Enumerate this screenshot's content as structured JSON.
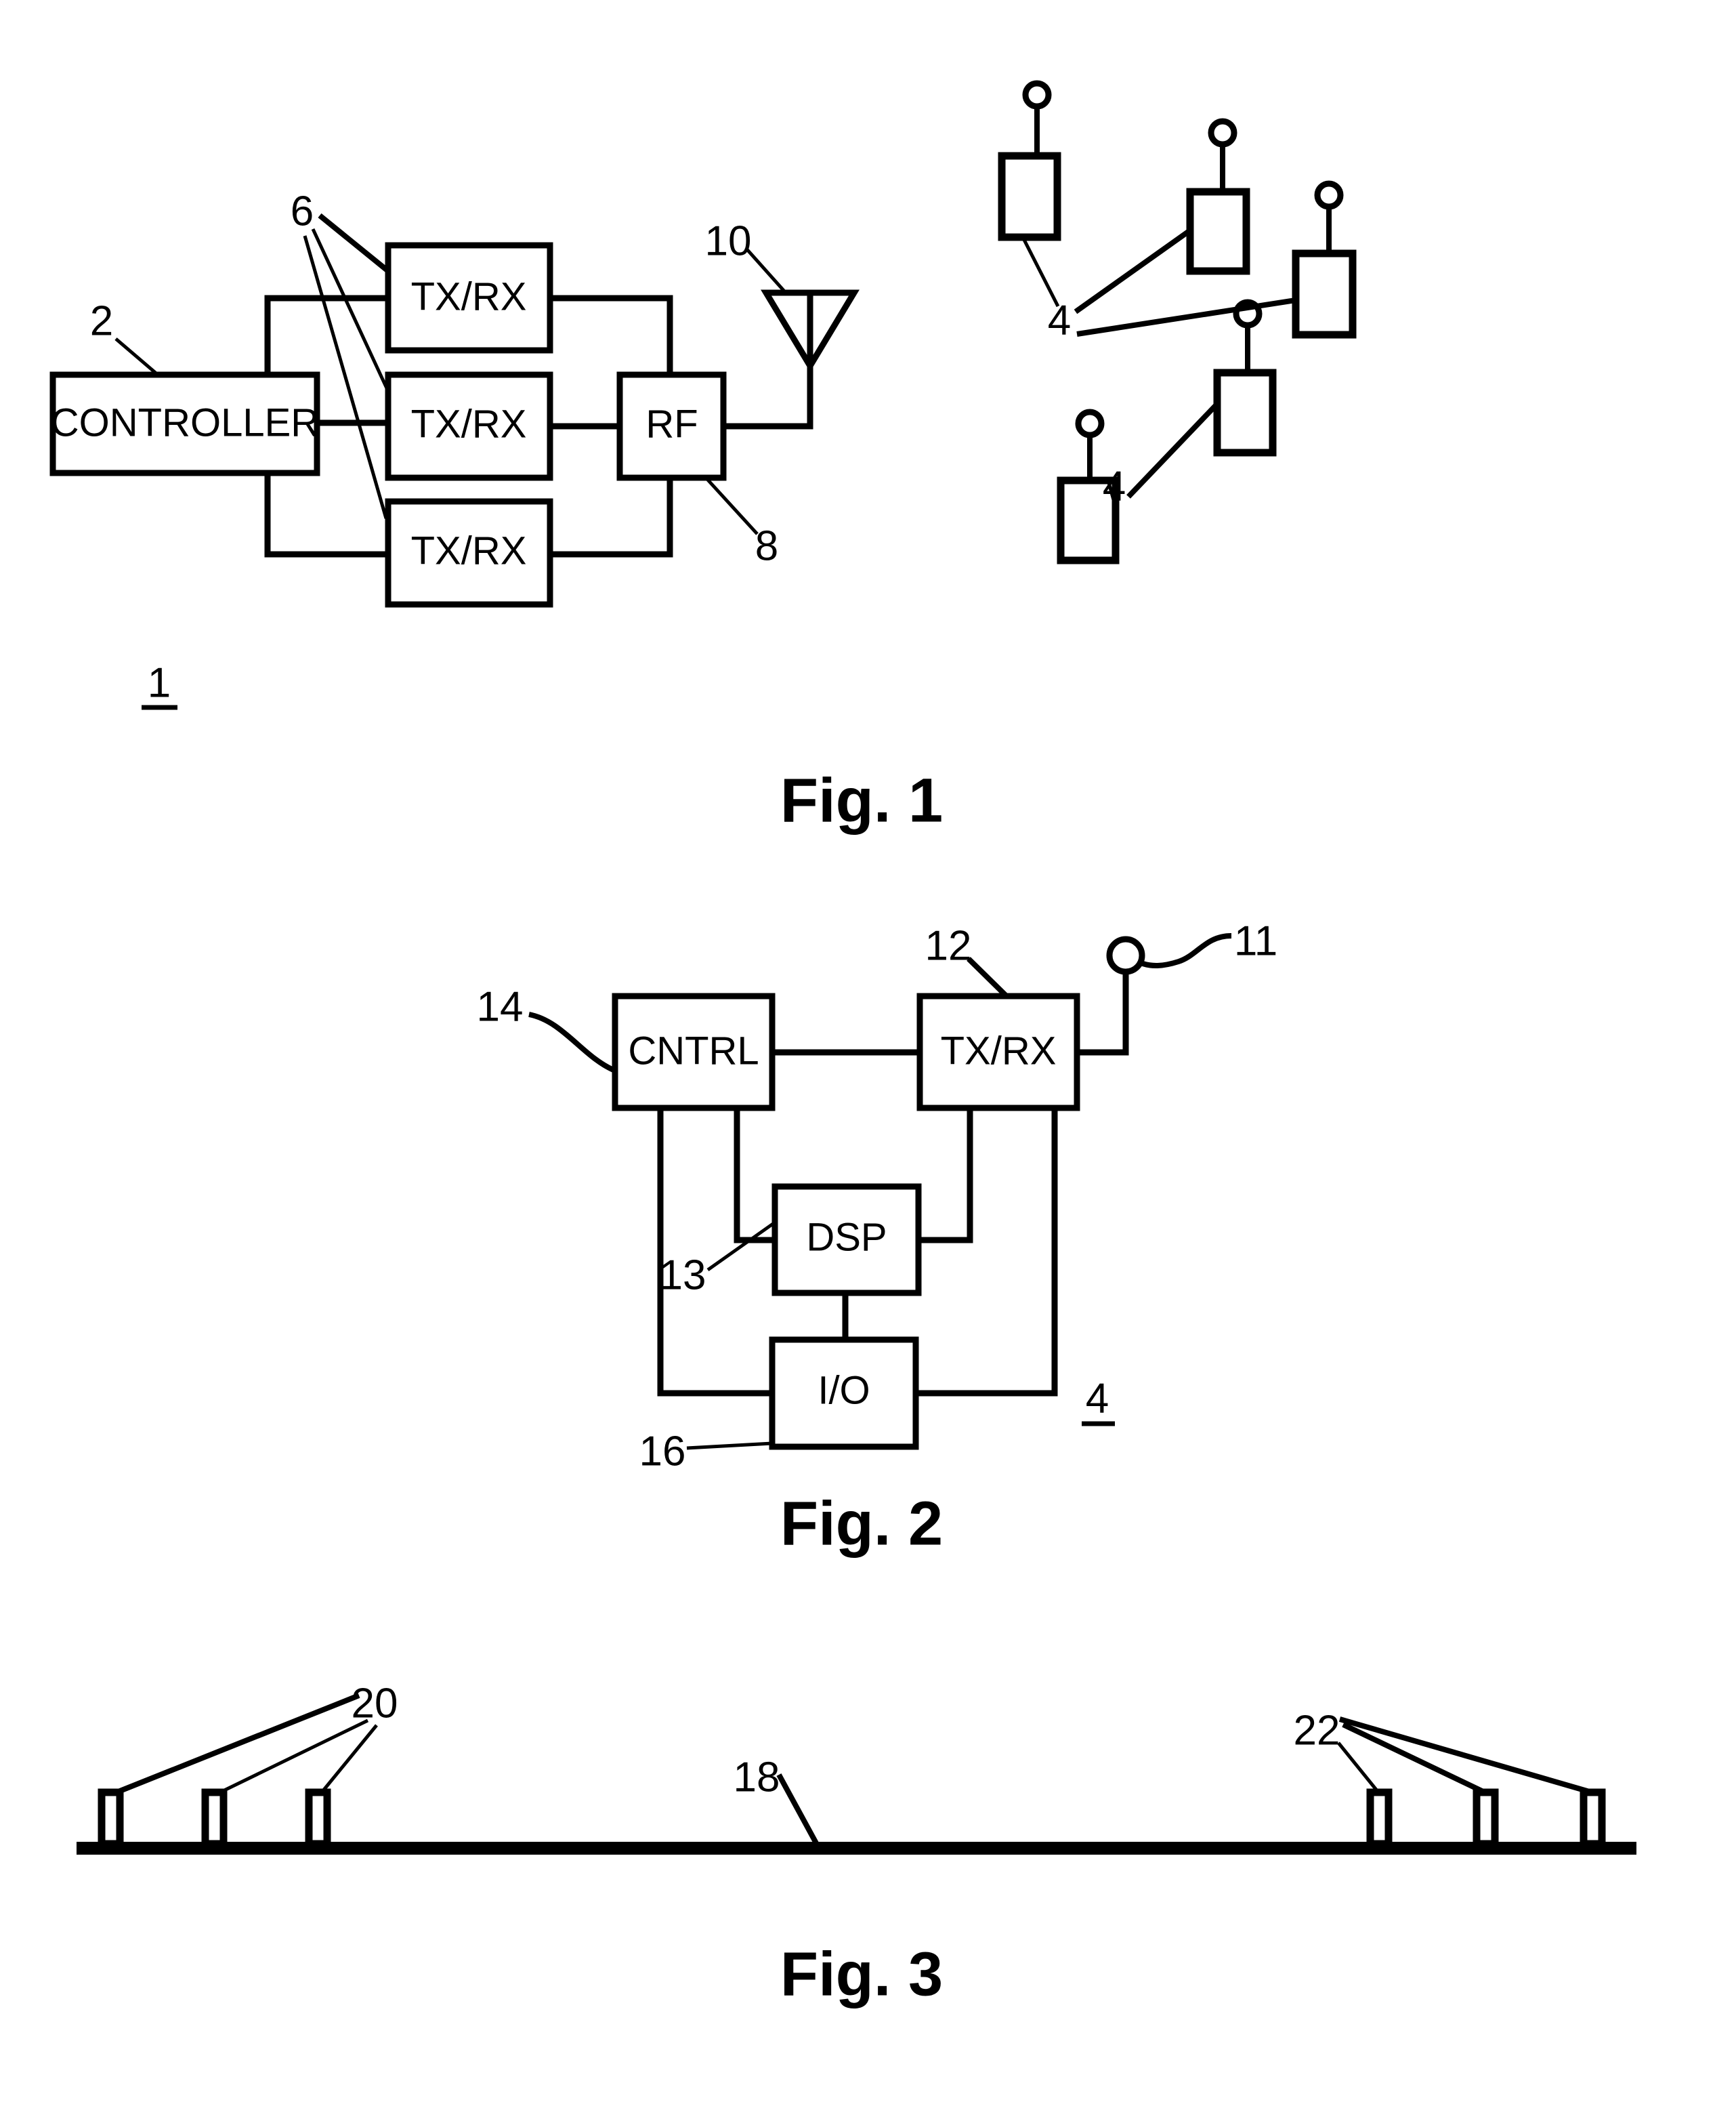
{
  "document": {
    "type": "patent-drawing-sheet",
    "background_color": "#ffffff",
    "ink_color": "#000000"
  },
  "figures": [
    {
      "id": "fig1",
      "caption": "Fig. 1",
      "assembly_label": "1",
      "blocks": [
        {
          "id": "controller",
          "label": "CONTROLLER",
          "ref": "2"
        },
        {
          "id": "txrx_top",
          "label": "TX/RX",
          "ref": "6"
        },
        {
          "id": "txrx_mid",
          "label": "TX/RX",
          "ref": "6"
        },
        {
          "id": "txrx_bot",
          "label": "TX/RX",
          "ref": "6"
        },
        {
          "id": "rf",
          "label": "RF",
          "ref": "8"
        }
      ],
      "antenna": {
        "ref": "10",
        "icon": "dipole-antenna-icon"
      },
      "reference_numerals": [
        "2",
        "6",
        "8",
        "10",
        "1"
      ],
      "mobile_stations": {
        "ref": "4",
        "count": 5,
        "icon": "mobile-station-icon",
        "group_labels": [
          "4",
          "4"
        ]
      }
    },
    {
      "id": "fig2",
      "caption": "Fig. 2",
      "assembly_label": "4",
      "blocks": [
        {
          "id": "cntrl",
          "label": "CNTRL",
          "ref": "14"
        },
        {
          "id": "txrx",
          "label": "TX/RX",
          "ref": "12"
        },
        {
          "id": "dsp",
          "label": "DSP",
          "ref": "13"
        },
        {
          "id": "io",
          "label": "I/O",
          "ref": "16"
        }
      ],
      "antenna": {
        "ref": "11",
        "icon": "loop-antenna-icon"
      },
      "reference_numerals": [
        "11",
        "12",
        "13",
        "14",
        "16",
        "4"
      ]
    },
    {
      "id": "fig3",
      "caption": "Fig. 3",
      "baseline_ref": "18",
      "left_group_ref": "20",
      "right_group_ref": "22",
      "left_marker_count": 3,
      "right_marker_count": 3,
      "reference_numerals": [
        "18",
        "20",
        "22"
      ]
    }
  ],
  "fig1": {
    "caption": "Fig. 1",
    "assembly_label": "1",
    "controller_label": "CONTROLLER",
    "txrx_top_label": "TX/RX",
    "txrx_mid_label": "TX/RX",
    "txrx_bot_label": "TX/RX",
    "rf_label": "RF",
    "ref_2": "2",
    "ref_6": "6",
    "ref_8": "8",
    "ref_10": "10",
    "ref_4_upper": "4",
    "ref_4_lower": "4"
  },
  "fig2": {
    "caption": "Fig. 2",
    "assembly_label": "4",
    "cntrl_label": "CNTRL",
    "txrx_label": "TX/RX",
    "dsp_label": "DSP",
    "io_label": "I/O",
    "ref_11": "11",
    "ref_12": "12",
    "ref_13": "13",
    "ref_14": "14",
    "ref_16": "16"
  },
  "fig3": {
    "caption": "Fig. 3",
    "ref_18": "18",
    "ref_20": "20",
    "ref_22": "22"
  }
}
